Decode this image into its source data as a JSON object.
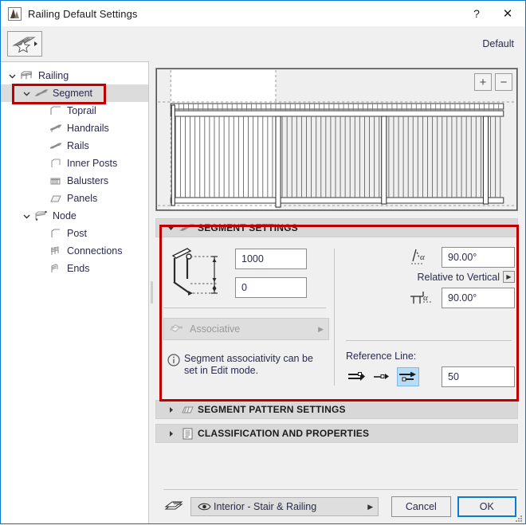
{
  "window": {
    "title": "Railing Default Settings",
    "help_label": "?",
    "close_label": "✕",
    "accent_color": "#0a7bd4",
    "annotation_color": "#c00000"
  },
  "toolbar": {
    "favorites_icon": "favorites-railing-star-icon",
    "default_label": "Default"
  },
  "sidebar": {
    "items": [
      {
        "label": "Railing",
        "icon": "railing-icon",
        "level": 1,
        "twisty": "down",
        "selected": false
      },
      {
        "label": "Segment",
        "icon": "segment-icon",
        "level": 2,
        "twisty": "down",
        "selected": true
      },
      {
        "label": "Toprail",
        "icon": "toprail-icon",
        "level": 3,
        "twisty": "none",
        "selected": false
      },
      {
        "label": "Handrails",
        "icon": "handrails-icon",
        "level": 3,
        "twisty": "none",
        "selected": false
      },
      {
        "label": "Rails",
        "icon": "rails-icon",
        "level": 3,
        "twisty": "none",
        "selected": false
      },
      {
        "label": "Inner Posts",
        "icon": "inner-posts-icon",
        "level": 3,
        "twisty": "none",
        "selected": false
      },
      {
        "label": "Balusters",
        "icon": "balusters-icon",
        "level": 3,
        "twisty": "none",
        "selected": false
      },
      {
        "label": "Panels",
        "icon": "panels-icon",
        "level": 3,
        "twisty": "none",
        "selected": false
      },
      {
        "label": "Node",
        "icon": "node-icon",
        "level": 2,
        "twisty": "down",
        "selected": false
      },
      {
        "label": "Post",
        "icon": "post-icon",
        "level": 3,
        "twisty": "none",
        "selected": false
      },
      {
        "label": "Connections",
        "icon": "connections-icon",
        "level": 3,
        "twisty": "none",
        "selected": false
      },
      {
        "label": "Ends",
        "icon": "ends-icon",
        "level": 3,
        "twisty": "none",
        "selected": false
      }
    ]
  },
  "preview": {
    "zoom_in_label": "+",
    "zoom_out_label": "−"
  },
  "panels": {
    "segment_settings": {
      "title": "SEGMENT SETTINGS",
      "expanded": true,
      "height_value": "1000",
      "offset_value": "0",
      "associative_label": "Associative",
      "info_text": "Segment associativity can be set in Edit mode.",
      "angle_top_value": "90.00°",
      "angle_bottom_value": "90.00°",
      "relative_label": "Relative to Vertical",
      "reference_line_label": "Reference Line:",
      "reference_line_offset": "50",
      "reference_line_options": [
        "ref-line-outer-icon",
        "ref-line-center-icon",
        "ref-line-inner-icon"
      ],
      "reference_line_selected_index": 2
    },
    "segment_pattern_settings": {
      "title": "SEGMENT PATTERN SETTINGS",
      "expanded": false
    },
    "classification_and_properties": {
      "title": "CLASSIFICATION AND PROPERTIES",
      "expanded": false
    }
  },
  "bottom": {
    "layer_name": "Interior - Stair & Railing",
    "cancel_label": "Cancel",
    "ok_label": "OK"
  }
}
